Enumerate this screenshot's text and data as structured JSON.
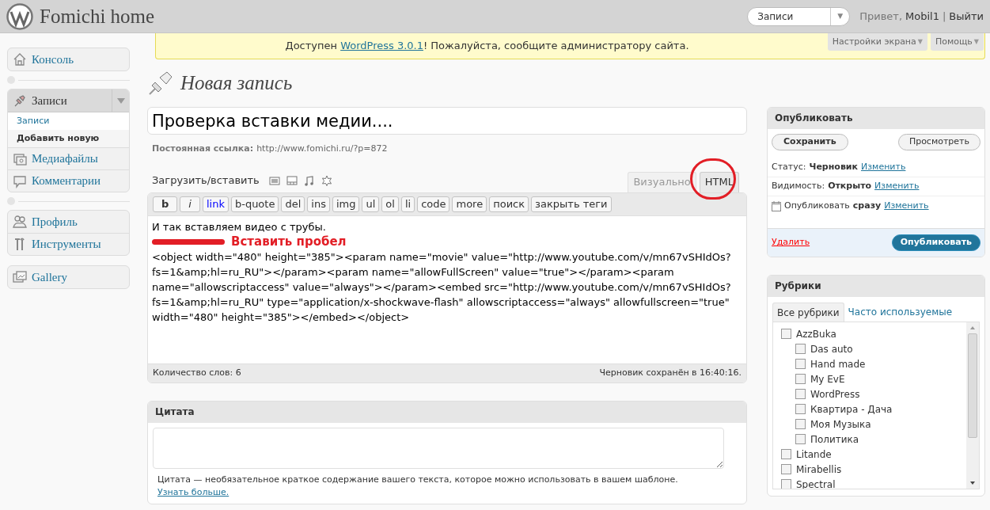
{
  "header": {
    "site_title": "Fomichi home",
    "favorites": {
      "value": "Записи",
      "caret": "▼"
    },
    "greeting": "Привет,",
    "user": "Mobil1",
    "separator": "|",
    "logout": "Выйти"
  },
  "notice": {
    "before": "Доступен ",
    "link": "WordPress 3.0.1",
    "after": "! Пожалуйста, сообщите администратору сайта."
  },
  "screen_tabs": [
    {
      "label": "Настройки экрана",
      "caret": "▼"
    },
    {
      "label": "Помощь",
      "caret": "▼"
    }
  ],
  "menu": [
    {
      "separator": true,
      "items": [
        {
          "label": "Консоль",
          "expanded": false
        }
      ]
    },
    {
      "separator": true,
      "items": [
        {
          "label": "Записи",
          "expanded": true,
          "submenu": [
            {
              "label": "Записи",
              "selected": false
            },
            {
              "label": "Добавить новую",
              "selected": true
            }
          ]
        },
        {
          "label": "Медиафайлы",
          "expanded": false
        },
        {
          "label": "Комментарии",
          "expanded": false
        }
      ]
    },
    {
      "separator": false,
      "items": [
        {
          "label": "Профиль",
          "expanded": false
        },
        {
          "label": "Инструменты",
          "expanded": false
        }
      ]
    },
    {
      "separator": false,
      "items": [
        {
          "label": "Gallery",
          "expanded": false
        }
      ]
    }
  ],
  "page_title": "Новая запись",
  "post": {
    "title": "Проверка вставки медии....",
    "permalink_label": "Постоянная ссылка:",
    "permalink": "http://www.fomichi.ru/?p=872"
  },
  "editor": {
    "upload_label": "Загрузить/вставить",
    "media_buttons": [
      {
        "kind": "image"
      },
      {
        "kind": "video"
      },
      {
        "kind": "audio"
      },
      {
        "kind": "media"
      }
    ],
    "tabs": [
      {
        "label": "Визуально",
        "selected": false,
        "circled": false
      },
      {
        "label": "HTML",
        "selected": true,
        "circled": true
      }
    ],
    "quicktags": [
      {
        "label": "b",
        "kind": "bold"
      },
      {
        "label": "i",
        "kind": "italic"
      },
      {
        "label": "link",
        "kind": "link"
      },
      {
        "label": "b-quote",
        "kind": "plain"
      },
      {
        "label": "del",
        "kind": "plain"
      },
      {
        "label": "ins",
        "kind": "plain"
      },
      {
        "label": "img",
        "kind": "plain"
      },
      {
        "label": "ul",
        "kind": "plain"
      },
      {
        "label": "ol",
        "kind": "plain"
      },
      {
        "label": "li",
        "kind": "plain"
      },
      {
        "label": "code",
        "kind": "plain"
      },
      {
        "label": "more",
        "kind": "plain"
      },
      {
        "label": "поиск",
        "kind": "plain"
      },
      {
        "label": "закрыть теги",
        "kind": "plain"
      }
    ],
    "content": [
      {
        "kind": "text",
        "text": "И так вставляем видео с трубы."
      },
      {
        "kind": "annotation",
        "text": "Вставить пробел"
      },
      {
        "kind": "code",
        "text": "<object width=\"480\" height=\"385\"><param name=\"movie\" value=\"http://www.youtube.com/v/mn67vSHIdOs?fs=1&amp;hl=ru_RU\"></param><param name=\"allowFullScreen\" value=\"true\"></param><param name=\"allowscriptaccess\" value=\"always\"></param><embed src=\"http://www.youtube.com/v/mn67vSHIdOs?fs=1&amp;hl=ru_RU\" type=\"application/x-shockwave-flash\" allowscriptaccess=\"always\" allowfullscreen=\"true\" width=\"480\" height=\"385\"></embed></object>"
      }
    ],
    "word_count": "Количество слов: 6",
    "autosave": "Черновик сохранён в 16:40:16."
  },
  "excerpt": {
    "title": "Цитата",
    "help": "Цитата — необязательное краткое содержание вашего текста, которое можно использовать в вашем шаблоне. ",
    "help_link": "Узнать больше."
  },
  "publish": {
    "title": "Опубликовать",
    "save": "Сохранить",
    "preview": "Просмотреть",
    "rows": [
      {
        "kind": "plain",
        "label": "Статус:",
        "value": "Черновик",
        "link": "Изменить"
      },
      {
        "kind": "plain",
        "label": "Видимость:",
        "value": "Открыто",
        "link": "Изменить"
      },
      {
        "kind": "calendar",
        "label": "Опубликовать",
        "value": "сразу",
        "link": "Изменить"
      }
    ],
    "delete": "Удалить",
    "publish": "Опубликовать"
  },
  "categories": {
    "title": "Рубрики",
    "tabs": [
      {
        "label": "Все рубрики",
        "selected": true
      },
      {
        "label": "Часто используемые",
        "selected": false
      }
    ],
    "items": [
      {
        "label": "AzzBuka",
        "checked": false,
        "children": [
          {
            "label": "Das auto",
            "checked": false
          },
          {
            "label": "Hand made",
            "checked": false
          },
          {
            "label": "My EvE",
            "checked": false
          },
          {
            "label": "WordPress",
            "checked": false
          },
          {
            "label": "Квартира - Дача",
            "checked": false
          },
          {
            "label": "Моя Музыка",
            "checked": false
          },
          {
            "label": "Политика",
            "checked": false
          }
        ]
      },
      {
        "label": "Litande",
        "checked": false
      },
      {
        "label": "Mirabellis",
        "checked": false
      },
      {
        "label": "Spectral",
        "checked": false
      }
    ]
  }
}
